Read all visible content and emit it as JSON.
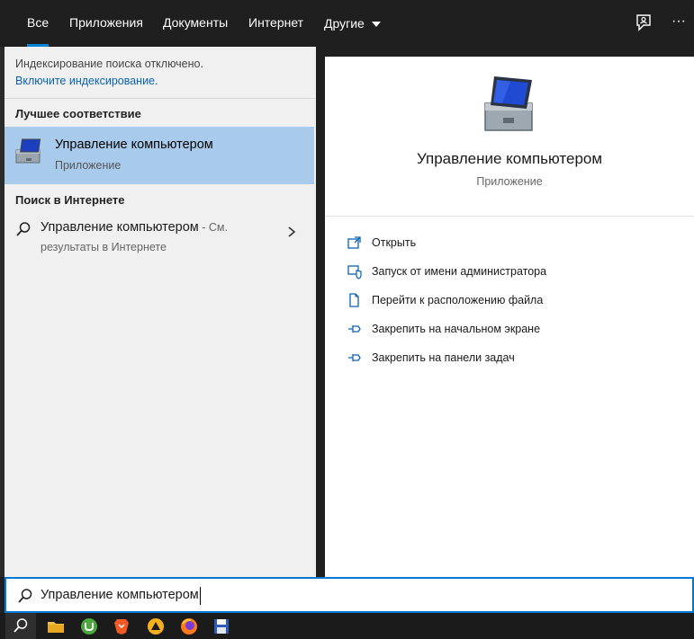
{
  "tabs": [
    {
      "label": "Все"
    },
    {
      "label": "Приложения"
    },
    {
      "label": "Документы"
    },
    {
      "label": "Интернет"
    },
    {
      "label": "Другие"
    }
  ],
  "top_icons": [
    "feedback-icon",
    "more-icon"
  ],
  "top_more_label": "···",
  "left": {
    "indexing_notice": "Индексирование поиска отключено.",
    "indexing_link": "Включите индексирование.",
    "best_match_header": "Лучшее соответствие",
    "best_match": {
      "title": "Управление компьютером",
      "subtitle": "Приложение",
      "icon": "computer-management-icon"
    },
    "web_header": "Поиск в Интернете",
    "web_result": {
      "title": "Управление компьютером",
      "suffix": " - См.",
      "line2": "результаты в Интернете"
    }
  },
  "right": {
    "app_title": "Управление компьютером",
    "app_subtitle": "Приложение",
    "actions": [
      {
        "label": "Открыть",
        "icon": "open-icon"
      },
      {
        "label": "Запуск от имени администратора",
        "icon": "shield-icon"
      },
      {
        "label": "Перейти к расположению файла",
        "icon": "file-location-icon"
      },
      {
        "label": "Закрепить на начальном экране",
        "icon": "pin-icon"
      },
      {
        "label": "Закрепить на панели задач",
        "icon": "pin-icon"
      }
    ]
  },
  "search": {
    "value": "Управление компьютером"
  },
  "taskbar": {
    "icons": [
      "search-icon",
      "file-explorer-icon",
      "utorrent-icon",
      "brave-icon",
      "app-icon",
      "firefox-icon",
      "save-icon"
    ]
  },
  "colors": {
    "accent": "#0078d7",
    "selection": "#a8cbeb",
    "link": "#0a62b0"
  }
}
